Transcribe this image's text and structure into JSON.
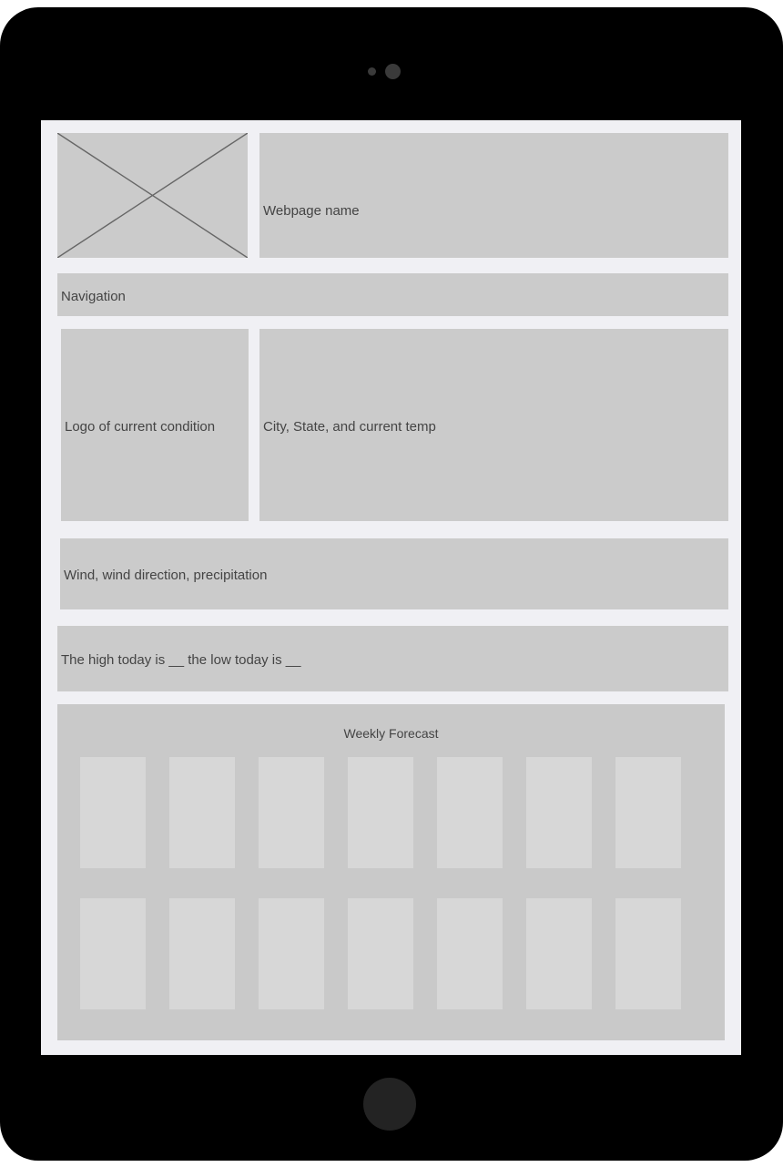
{
  "device": {
    "type": "tablet-wireframe-mockup",
    "frame_color": "#000000",
    "screen_background": "#f0f0f4",
    "block_color": "#cbcbcb",
    "card_color": "#d7d7d7",
    "text_color": "#444444",
    "sensors": [
      {
        "name": "ambient-light-sensor"
      },
      {
        "name": "front-camera"
      }
    ],
    "home_button": "home-button"
  },
  "page": {
    "header": {
      "logo_placeholder_label": "",
      "site_name": "Webpage name"
    },
    "navigation": {
      "label": "Navigation"
    },
    "current_conditions": {
      "condition_logo_label": "Logo of current condition",
      "location_temp_label": "City, State, and current temp"
    },
    "wind": {
      "label": "Wind, wind direction, precipitation"
    },
    "high_low": {
      "label": "The high today is __ the low today is __"
    },
    "forecast": {
      "title": "Weekly Forecast",
      "rows": [
        {
          "cards": [
            "",
            "",
            "",
            "",
            "",
            "",
            ""
          ]
        },
        {
          "cards": [
            "",
            "",
            "",
            "",
            "",
            "",
            ""
          ]
        }
      ]
    }
  }
}
